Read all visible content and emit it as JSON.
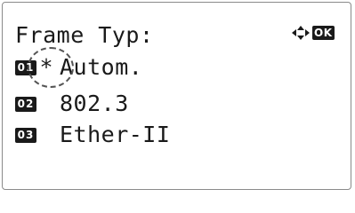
{
  "screen": {
    "title": "Frame Typ:",
    "nav_icon": "up-down-arrows-icon",
    "ok_label": "OK"
  },
  "options": [
    {
      "number": "01",
      "marker": "*",
      "label": "Autom.",
      "selected": true
    },
    {
      "number": "02",
      "marker": "",
      "label": "802.3",
      "selected": false
    },
    {
      "number": "03",
      "marker": "",
      "label": "Ether-II",
      "selected": false
    }
  ]
}
